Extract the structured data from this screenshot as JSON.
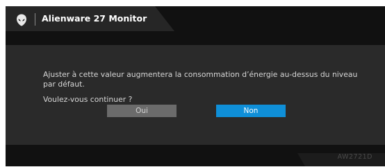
{
  "header": {
    "logo_icon": "alien-head-icon",
    "title": "Alienware 27 Monitor"
  },
  "dialog": {
    "message": "Ajuster à cette valeur augmentera la consommation d’énergie au-dessus du niveau par défaut.",
    "prompt": "Voulez-vous continuer ?",
    "buttons": {
      "yes_label": "Oui",
      "no_label": "Non",
      "selected": "Non"
    }
  },
  "footer": {
    "model": "AW2721D"
  },
  "colors": {
    "highlight": "#0f8fd8",
    "panel": "#2a2a2a",
    "background": "#111111",
    "button_inactive": "#6b6b6b"
  }
}
